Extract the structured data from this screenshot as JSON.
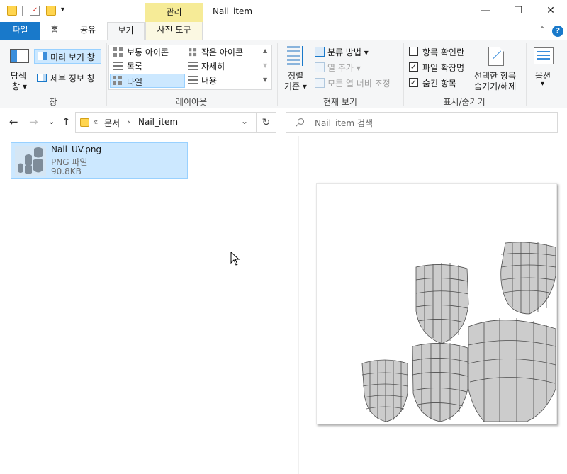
{
  "titlebar": {
    "context_tab": "관리",
    "window_title": "Nail_item",
    "minimize": "—",
    "maximize": "☐",
    "close": "✕"
  },
  "tabs": {
    "file": "파일",
    "home": "홈",
    "share": "공유",
    "view": "보기",
    "picture_tools": "사진 도구",
    "help": "?",
    "collapse": "⌃"
  },
  "ribbon": {
    "pane": {
      "nav_pane_line1": "탐색",
      "nav_pane_line2": "창 ▾",
      "preview_pane": "미리 보기 창",
      "details_pane": "세부 정보 창",
      "group_label": "창"
    },
    "layout": {
      "medium_icons": "보통 아이콘",
      "small_icons": "작은 아이콘",
      "list": "목록",
      "details": "자세히",
      "tiles": "타일",
      "content": "내용",
      "group_label": "레이아웃"
    },
    "current_view": {
      "sort_line1": "정렬",
      "sort_line2": "기준 ▾",
      "group_by": "분류 방법 ▾",
      "add_columns": "열 추가 ▾",
      "size_all_columns": "모든 열 너비 조정",
      "group_label": "현재 보기"
    },
    "show_hide": {
      "item_checkboxes": "항목 확인란",
      "file_extensions": "파일 확장명",
      "hidden_items": "숨긴 항목",
      "hide_selected_line1": "선택한 항목",
      "hide_selected_line2": "숨기기/해제",
      "group_label": "표시/숨기기",
      "item_checkboxes_checked": false,
      "file_extensions_checked": true,
      "hidden_items_checked": true
    },
    "options": {
      "label": "옵션",
      "arrow": "▾"
    }
  },
  "addressbar": {
    "back": "←",
    "forward": "→",
    "recent": "⌄",
    "up": "↑",
    "overflow": "«",
    "crumbs": [
      "문서",
      "Nail_item"
    ],
    "crumb_sep": "›",
    "dropdown": "⌄",
    "refresh": "↻",
    "search_placeholder": "Nail_item 검색"
  },
  "files": [
    {
      "name": "Nail_UV.png",
      "type": "PNG 파일",
      "size": "90.8KB"
    }
  ],
  "colors": {
    "file_tab": "#1979ca",
    "selected_tile": "#cce8ff",
    "context_tab": "#f6eb97",
    "uv_fill": "#cccccc",
    "uv_stroke": "#555555"
  }
}
